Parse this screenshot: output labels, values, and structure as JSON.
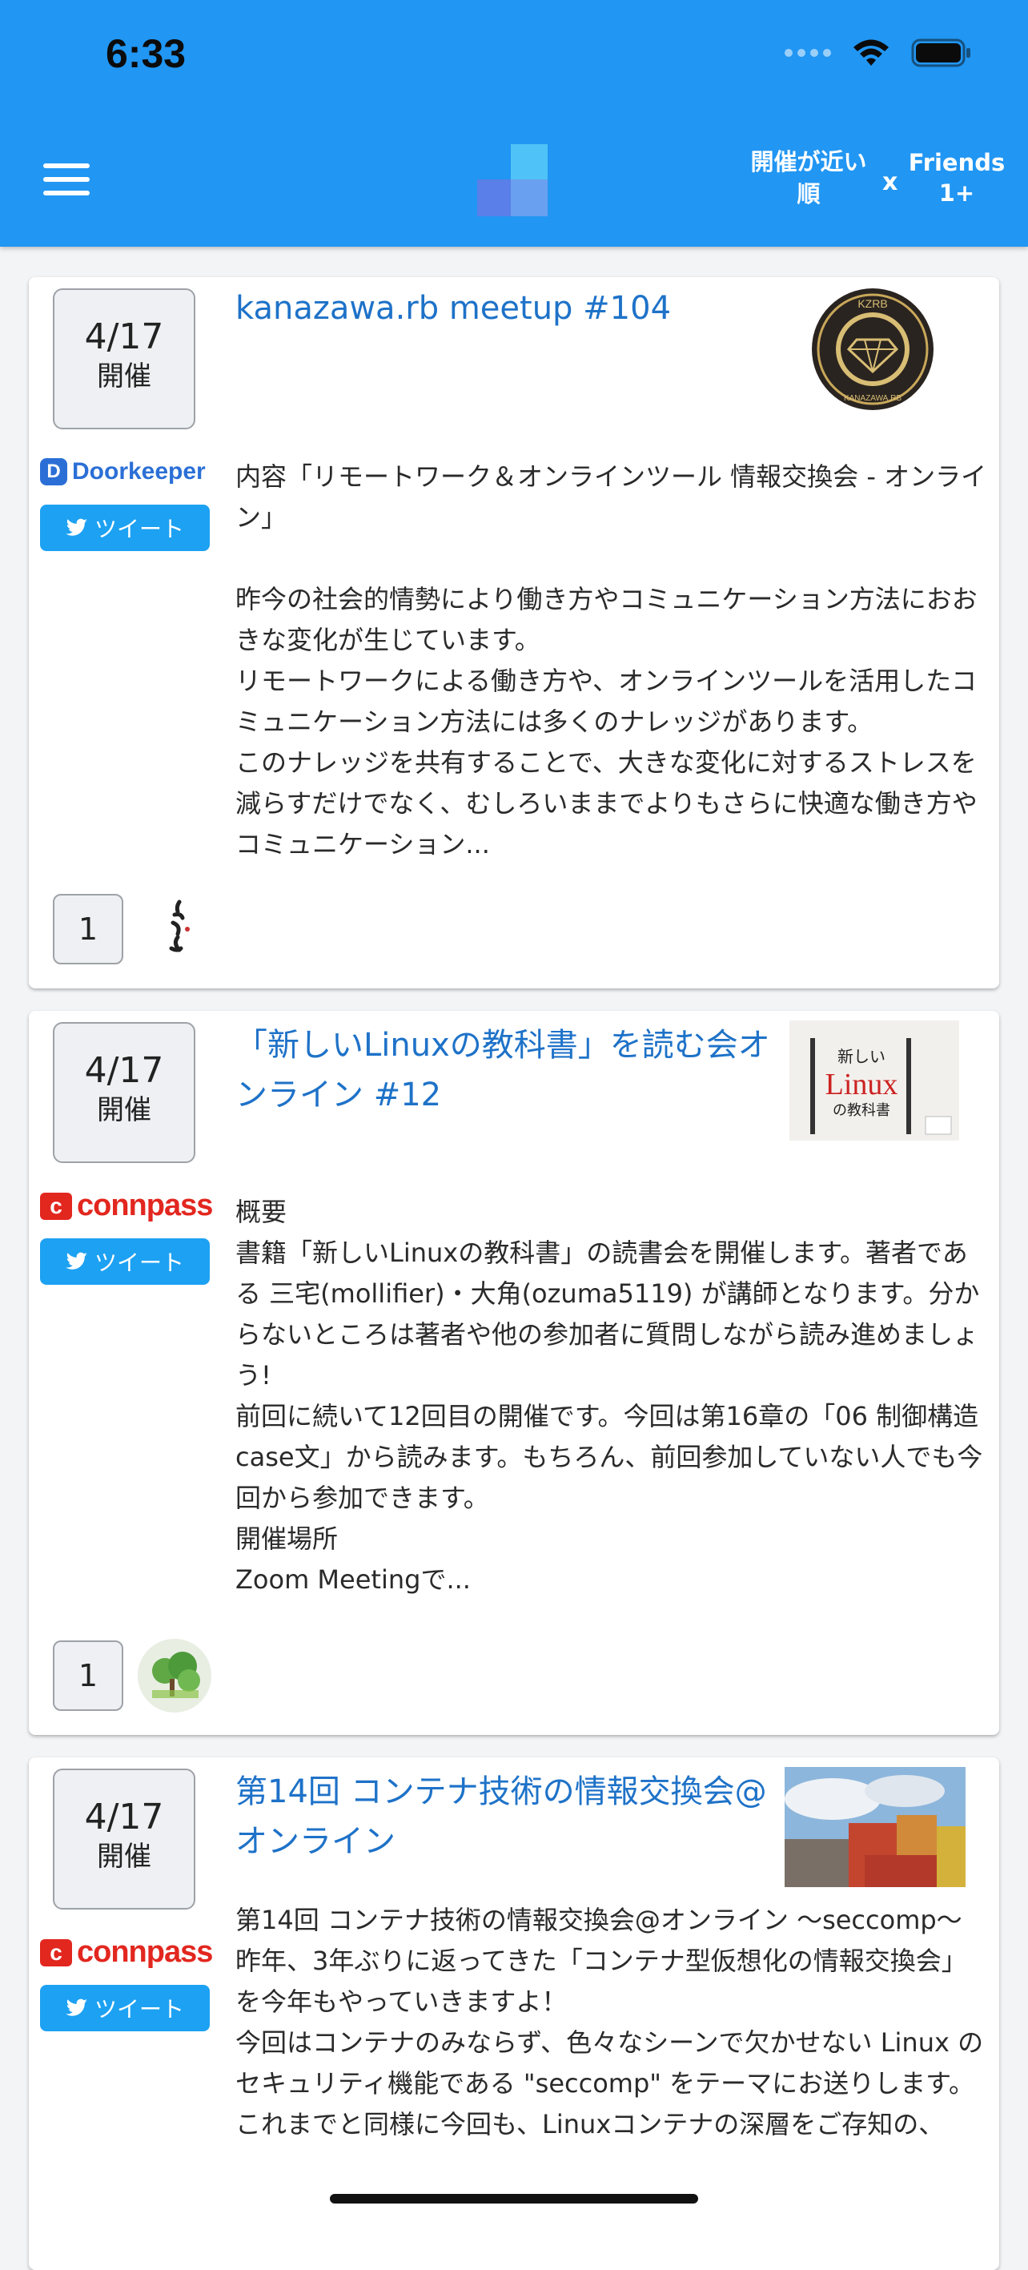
{
  "status_bar": {
    "time": "6:33"
  },
  "header": {
    "sort_label_line1": "開催が近い",
    "sort_label_line2": "順",
    "times": "x",
    "friends_line1": "Friends",
    "friends_line2": "1+"
  },
  "events": [
    {
      "date": "4/17",
      "date_suffix": "開催",
      "provider": "Doorkeeper",
      "provider_mark": "D",
      "tweet_label": "ツイート",
      "title": "kanazawa.rb meetup #104",
      "thumbnail_text_top": "KZRB",
      "thumbnail_text_bottom": "KANAZAWA.RB",
      "description": "内容「リモートワーク＆オンラインツール 情報交換会 - オンライン」\n\n昨今の社会的情勢により働き方やコミュニケーション方法におおきな変化が生じています。\nリモートワークによる働き方や、オンラインツールを活用したコミュニケーション方法には多くのナレッジがあります。\nこのナレッジを共有することで、大きな変化に対するストレスを減らすだけでなく、むしろいままでよりもさらに快適な働き方やコミュニケーション...",
      "attendee_count": "1"
    },
    {
      "date": "4/17",
      "date_suffix": "開催",
      "provider": "connpass",
      "provider_mark": "c",
      "tweet_label": "ツイート",
      "title": "「新しいLinuxの教科書」を読む会オンライン #12",
      "thumbnail_text_top": "新しい",
      "thumbnail_text_main": "Linux",
      "thumbnail_text_bottom": "の教科書",
      "description": "概要\n書籍「新しいLinuxの教科書」の読書会を開催します。著者である 三宅(mollifier)・大角(ozuma5119) が講師となります。分からないところは著者や他の参加者に質問しながら読み進めましょう!\n前回に続いて12回目の開催です。今回は第16章の「06 制御構造 case文」から読みます。もちろん、前回参加していない人でも今回から参加できます。\n開催場所\nZoom Meetingで...",
      "attendee_count": "1"
    },
    {
      "date": "4/17",
      "date_suffix": "開催",
      "provider": "connpass",
      "provider_mark": "c",
      "tweet_label": "ツイート",
      "title": "第14回 コンテナ技術の情報交換会@オンライン",
      "description": "第14回 コンテナ技術の情報交換会@オンライン 〜seccomp〜\n昨年、3年ぶりに返ってきた「コンテナ型仮想化の情報交換会」を今年もやっていきますよ！\n今回はコンテナのみならず、色々なシーンで欠かせない Linux のセキュリティ機能である \"seccomp\" をテーマにお送りします。\nこれまでと同様に今回も、Linuxコンテナの深層をご存知の、"
    }
  ],
  "colors": {
    "header_bg": "#2196f3",
    "title_link": "#1e72c8",
    "tweet_bg": "#1da1f2",
    "connpass_red": "#e2271f",
    "doorkeeper_blue": "#2b6fd6"
  }
}
